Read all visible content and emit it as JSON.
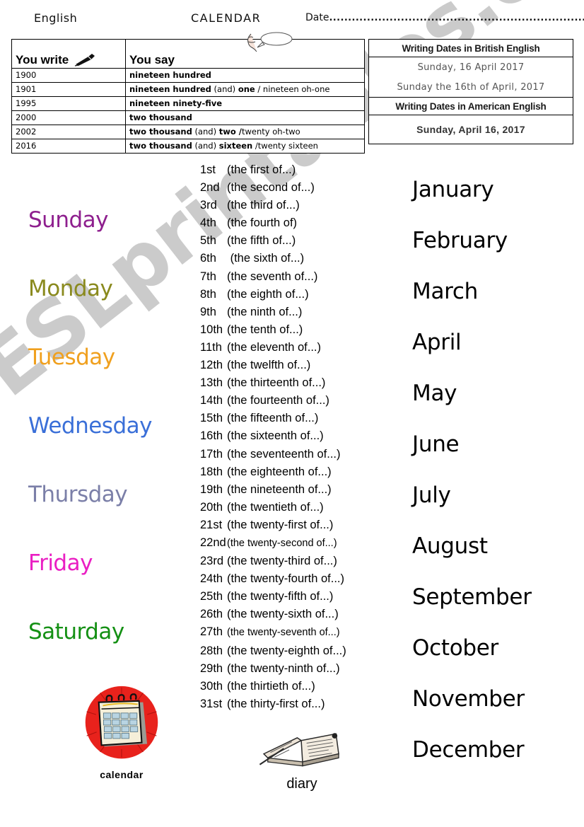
{
  "header": {
    "subject": "English",
    "title": "CALENDAR",
    "date_label": "Date",
    "date_dots": "..........................................................................."
  },
  "say_table": {
    "col_write_label": "You write",
    "col_say_label": "You say",
    "write_icon": "pen-icon",
    "say_icon": "speaking-mouth-icon",
    "rows": [
      {
        "write": "1900",
        "bold1": "nineteen hundred",
        "mid": "",
        "bold2": "",
        "alt": ""
      },
      {
        "write": "1901",
        "bold1": "nineteen hundred",
        "mid": " (and) ",
        "bold2": "one",
        "alt": "  / nineteen oh-one"
      },
      {
        "write": "1995",
        "bold1": "nineteen ninety-five",
        "mid": "",
        "bold2": "",
        "alt": ""
      },
      {
        "write": "2000",
        "bold1": "two thousand",
        "mid": "",
        "bold2": "",
        "alt": ""
      },
      {
        "write": "2002",
        "bold1": "two thousand",
        "mid": " (and) ",
        "bold2": "two /",
        "alt": "twenty oh-two"
      },
      {
        "write": "2016",
        "bold1": "two thousand",
        "mid": " (and) ",
        "bold2": "sixteen",
        "alt": " /twenty sixteen"
      }
    ]
  },
  "dates_table": {
    "british_heading": "Writing Dates in British English",
    "british_examples": [
      "Sunday, 16 April 2017",
      "Sunday the 16th of April, 2017"
    ],
    "american_heading": "Writing Dates in American English",
    "american_examples": [
      "Sunday, April 16, 2017"
    ]
  },
  "days": [
    {
      "label": "Sunday",
      "color": "#8e1f8e"
    },
    {
      "label": "Monday",
      "color": "#8a8a1e"
    },
    {
      "label": "Tuesday",
      "color": "#f0a01e"
    },
    {
      "label": "Wednesday",
      "color": "#3a6fd8"
    },
    {
      "label": "Thursday",
      "color": "#7b7fa8"
    },
    {
      "label": "Friday",
      "color": "#ea1fc3"
    },
    {
      "label": "Saturday",
      "color": "#149014"
    }
  ],
  "ordinals": [
    {
      "num": "1st",
      "text": "(the first of...)"
    },
    {
      "num": "2nd",
      "text": "(the second of...)"
    },
    {
      "num": "3rd",
      "text": "(the third of...)"
    },
    {
      "num": "4th",
      "text": "(the fourth of)"
    },
    {
      "num": "5th",
      "text": "(the fifth of...)"
    },
    {
      "num": "6th",
      "text": " (the sixth of...)"
    },
    {
      "num": "7th",
      "text": "(the seventh of...)"
    },
    {
      "num": "8th",
      "text": "(the eighth of...)"
    },
    {
      "num": "9th",
      "text": "(the ninth of...)"
    },
    {
      "num": "10th",
      "text": "(the tenth of...)"
    },
    {
      "num": "11th",
      "text": "(the eleventh of...)"
    },
    {
      "num": "12th",
      "text": "(the twelfth of...)"
    },
    {
      "num": "13th",
      "text": "(the thirteenth of...)"
    },
    {
      "num": "14th",
      "text": "(the fourteenth of...)"
    },
    {
      "num": "15th",
      "text": "(the fifteenth of...)"
    },
    {
      "num": "16th",
      "text": "(the sixteenth of...)"
    },
    {
      "num": "17th",
      "text": "(the seventeenth of...)"
    },
    {
      "num": "18th",
      "text": "(the eighteenth of...)"
    },
    {
      "num": "19th",
      "text": "(the nineteenth of...)"
    },
    {
      "num": "20th",
      "text": "(the twentieth of...)"
    },
    {
      "num": "21st",
      "text": "(the twenty-first of...)"
    },
    {
      "num": "22nd",
      "text": "(the twenty-second of...)",
      "small": true
    },
    {
      "num": "23rd",
      "text": "(the twenty-third of...)"
    },
    {
      "num": "24th",
      "text": "(the twenty-fourth of...)"
    },
    {
      "num": "25th",
      "text": "(the twenty-fifth of...)"
    },
    {
      "num": "26th",
      "text": "(the twenty-sixth of...)"
    },
    {
      "num": "27th",
      "text": "(the twenty-seventh of...)",
      "small": true
    },
    {
      "num": "28th",
      "text": "(the twenty-eighth of...)"
    },
    {
      "num": "29th",
      "text": "(the twenty-ninth of...)"
    },
    {
      "num": "30th",
      "text": "(the thirtieth of...)"
    },
    {
      "num": "31st",
      "text": "(the thirty-first of...)"
    }
  ],
  "months": [
    "January",
    "February",
    "March",
    "April",
    "May",
    "June",
    "July",
    "August",
    "September",
    "October",
    "November",
    "December"
  ],
  "pictures": {
    "calendar_caption": "calendar",
    "calendar_icon": "wall-calendar-icon",
    "diary_caption": "diary",
    "diary_icon": "open-book-icon"
  },
  "watermark": "ESLprintables.com",
  "colors": {
    "watermark": "#c9c9c9",
    "calendar_badge": "#e8221c",
    "ink": "#000000"
  }
}
